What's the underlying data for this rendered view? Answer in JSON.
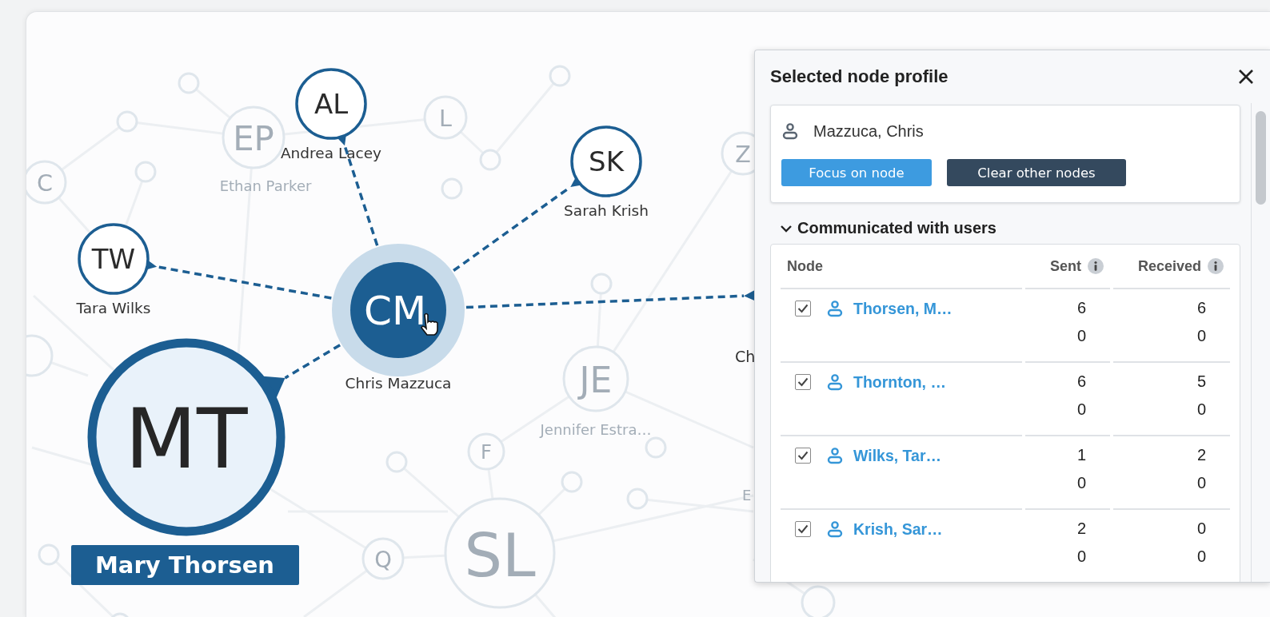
{
  "graph": {
    "nodes": [
      {
        "initials": "AL",
        "name": "Andrea Lacey",
        "kind": "connected"
      },
      {
        "initials": "L",
        "kind": "faded"
      },
      {
        "initials": "EP",
        "name": "Ethan Parker",
        "kind": "faded"
      },
      {
        "initials": "SK",
        "name": "Sarah Krish",
        "kind": "connected"
      },
      {
        "initials": "Z",
        "kind": "faded"
      },
      {
        "initials": "C",
        "kind": "faded"
      },
      {
        "initials": "TW",
        "name": "Tara Wilks",
        "kind": "connected"
      },
      {
        "initials": "CM",
        "name": "Chris Mazzuca",
        "kind": "selected"
      },
      {
        "initials": "MT",
        "name": "Mary Thorsen",
        "kind": "focus"
      },
      {
        "name": "Ch",
        "kind": "covered"
      },
      {
        "initials": "JE",
        "name": "Jennifer Estra…",
        "kind": "faded"
      },
      {
        "initials": "F",
        "kind": "faded"
      },
      {
        "name": "E",
        "kind": "faded_covered"
      },
      {
        "initials": "Q",
        "kind": "faded"
      },
      {
        "initials": "SL",
        "kind": "faded"
      }
    ]
  },
  "profile_panel": {
    "title": "Selected node profile",
    "user": "Mazzuca, Chris",
    "buttons": [
      {
        "label": "Focus on node",
        "kind": "primary"
      },
      {
        "label": "Clear other nodes",
        "kind": "dark"
      }
    ],
    "section": {
      "title": "Communicated with users",
      "expanded": true,
      "table": {
        "columns": [
          {
            "label": "Node",
            "info": false
          },
          {
            "label": "Sent",
            "info": true
          },
          {
            "label": "Received",
            "info": true
          }
        ],
        "rows": [
          {
            "checked": true,
            "name": "Thorsen, M…",
            "sent": [
              "6",
              "0"
            ],
            "received": [
              "6",
              "0"
            ]
          },
          {
            "checked": true,
            "name": "Thornton, …",
            "sent": [
              "6",
              "0"
            ],
            "received": [
              "5",
              "0"
            ]
          },
          {
            "checked": true,
            "name": "Wilks, Tar…",
            "sent": [
              "1",
              "0"
            ],
            "received": [
              "2",
              "0"
            ]
          },
          {
            "checked": true,
            "name": "Krish, Sar…",
            "sent": [
              "2",
              "0"
            ],
            "received": [
              "0",
              "0"
            ]
          }
        ]
      }
    }
  }
}
